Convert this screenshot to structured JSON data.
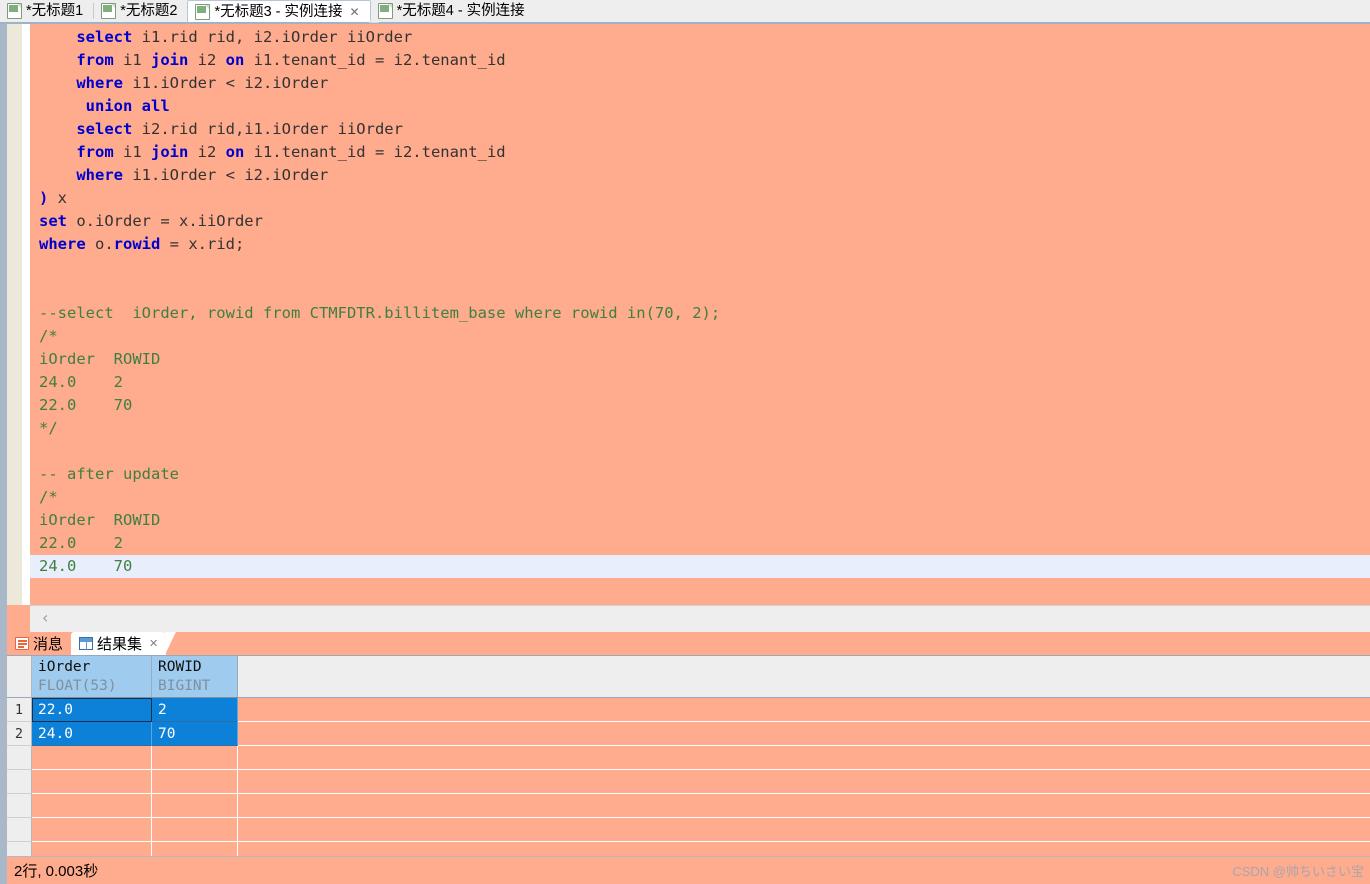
{
  "window": {
    "tabs": [
      {
        "label": "*无标题1",
        "icon": "sql-file-icon",
        "active": false,
        "closable": false
      },
      {
        "label": "*无标题2",
        "icon": "sql-file-icon",
        "active": false,
        "closable": false
      },
      {
        "label": "*无标题3 - 实例连接",
        "icon": "sql-file-icon",
        "active": true,
        "closable": true,
        "close_glyph": "✕"
      },
      {
        "label": "*无标题4 - 实例连接",
        "icon": "sql-file-icon",
        "active": false,
        "closable": false
      }
    ]
  },
  "editor": {
    "scroll_left_chevron": "‹",
    "lines": [
      {
        "indent": "    ",
        "tokens": [
          {
            "t": "kw",
            "v": "select"
          },
          {
            "t": "pl",
            "v": " i1.rid rid, i2.iOrder iiOrder"
          }
        ]
      },
      {
        "indent": "    ",
        "tokens": [
          {
            "t": "kw",
            "v": "from"
          },
          {
            "t": "pl",
            "v": " i1 "
          },
          {
            "t": "kw",
            "v": "join"
          },
          {
            "t": "pl",
            "v": " i2 "
          },
          {
            "t": "kw",
            "v": "on"
          },
          {
            "t": "pl",
            "v": " i1.tenant_id = i2.tenant_id"
          }
        ]
      },
      {
        "indent": "    ",
        "tokens": [
          {
            "t": "kw",
            "v": "where"
          },
          {
            "t": "pl",
            "v": " i1.iOrder < i2.iOrder"
          }
        ]
      },
      {
        "indent": "     ",
        "tokens": [
          {
            "t": "kw",
            "v": "union all"
          }
        ]
      },
      {
        "indent": "    ",
        "tokens": [
          {
            "t": "kw",
            "v": "select"
          },
          {
            "t": "pl",
            "v": " i2.rid rid,i1.iOrder iiOrder"
          }
        ]
      },
      {
        "indent": "    ",
        "tokens": [
          {
            "t": "kw",
            "v": "from"
          },
          {
            "t": "pl",
            "v": " i1 "
          },
          {
            "t": "kw",
            "v": "join"
          },
          {
            "t": "pl",
            "v": " i2 "
          },
          {
            "t": "kw",
            "v": "on"
          },
          {
            "t": "pl",
            "v": " i1.tenant_id = i2.tenant_id"
          }
        ]
      },
      {
        "indent": "    ",
        "tokens": [
          {
            "t": "kw",
            "v": "where"
          },
          {
            "t": "pl",
            "v": " i1.iOrder < i2.iOrder"
          }
        ]
      },
      {
        "indent": "",
        "tokens": [
          {
            "t": "kw",
            "v": ")"
          },
          {
            "t": "pl",
            "v": " x"
          }
        ]
      },
      {
        "indent": "",
        "tokens": [
          {
            "t": "kw",
            "v": "set"
          },
          {
            "t": "pl",
            "v": " o.iOrder = x.iiOrder"
          }
        ]
      },
      {
        "indent": "",
        "tokens": [
          {
            "t": "kw",
            "v": "where"
          },
          {
            "t": "pl",
            "v": " o."
          },
          {
            "t": "kw",
            "v": "rowid"
          },
          {
            "t": "pl",
            "v": " = x.rid;"
          }
        ]
      },
      {
        "indent": "",
        "tokens": []
      },
      {
        "indent": "",
        "tokens": []
      },
      {
        "indent": "",
        "tokens": [
          {
            "t": "cm",
            "v": "--select  iOrder, rowid from CTMFDTR.billitem_base where rowid in(70, 2);"
          }
        ]
      },
      {
        "indent": "",
        "tokens": [
          {
            "t": "cm",
            "v": "/*"
          }
        ]
      },
      {
        "indent": "",
        "tokens": [
          {
            "t": "cm",
            "v": "iOrder  ROWID"
          }
        ]
      },
      {
        "indent": "",
        "tokens": [
          {
            "t": "cm",
            "v": "24.0    2"
          }
        ]
      },
      {
        "indent": "",
        "tokens": [
          {
            "t": "cm",
            "v": "22.0    70"
          }
        ]
      },
      {
        "indent": "",
        "tokens": [
          {
            "t": "cm",
            "v": "*/"
          }
        ]
      },
      {
        "indent": "",
        "tokens": []
      },
      {
        "indent": "",
        "tokens": [
          {
            "t": "cm",
            "v": "-- after update"
          }
        ]
      },
      {
        "indent": "",
        "tokens": [
          {
            "t": "cm",
            "v": "/*"
          }
        ]
      },
      {
        "indent": "",
        "tokens": [
          {
            "t": "cm",
            "v": "iOrder  ROWID"
          }
        ]
      },
      {
        "indent": "",
        "tokens": [
          {
            "t": "cm",
            "v": "22.0    2"
          }
        ]
      },
      {
        "indent": "",
        "tokens": [
          {
            "t": "cm",
            "v": "24.0    70"
          }
        ],
        "current": true
      }
    ]
  },
  "bottom_panel": {
    "tabs": [
      {
        "label": "消息",
        "icon": "messages-icon",
        "active": false,
        "closable": false
      },
      {
        "label": "结果集",
        "icon": "grid-icon",
        "active": true,
        "closable": true,
        "close_glyph": "✕"
      }
    ],
    "result_grid": {
      "columns": [
        {
          "name": "iOrder",
          "type": "FLOAT(53)"
        },
        {
          "name": "ROWID",
          "type": "BIGINT"
        }
      ],
      "rows": [
        {
          "num": "1",
          "cells": [
            "22.0",
            "2"
          ]
        },
        {
          "num": "2",
          "cells": [
            "24.0",
            "70"
          ]
        }
      ],
      "empty_row_count": 5
    }
  },
  "status_bar": {
    "text": "2行, 0.003秒",
    "watermark": "CSDN @帅ちいさい宝"
  }
}
